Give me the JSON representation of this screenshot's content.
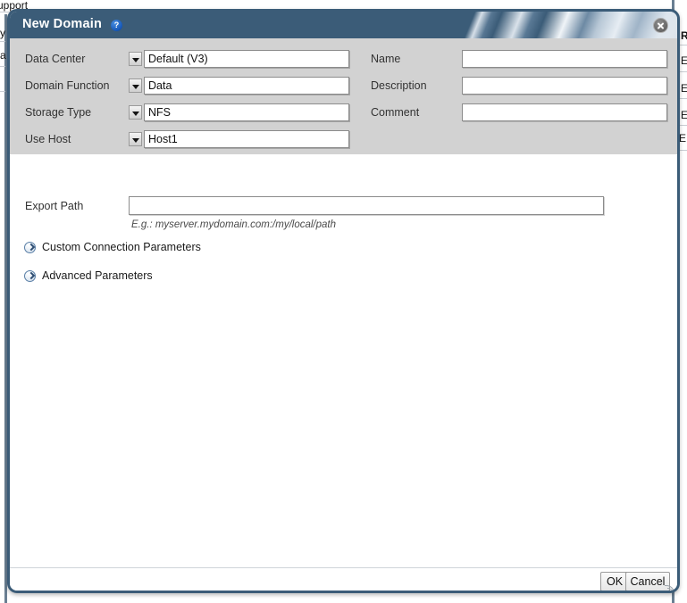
{
  "dialog": {
    "title": "New Domain",
    "help_icon": "?",
    "close_icon": "close-icon"
  },
  "form": {
    "left_column": [
      {
        "label": "Data Center",
        "value": "Default (V3)",
        "control": "dropdown"
      },
      {
        "label": "Domain Function",
        "value": "Data",
        "control": "dropdown"
      },
      {
        "label": "Storage Type",
        "value": "NFS",
        "control": "dropdown"
      },
      {
        "label": "Use Host",
        "value": "Host1",
        "control": "dropdown"
      }
    ],
    "right_column": [
      {
        "label": "Name",
        "value": "",
        "placeholder": "",
        "control": "text"
      },
      {
        "label": "Description",
        "value": "",
        "placeholder": "",
        "control": "text"
      },
      {
        "label": "Comment",
        "value": "",
        "placeholder": "",
        "control": "text"
      }
    ],
    "export": {
      "label": "Export Path",
      "value": "",
      "placeholder": "",
      "hint": "E.g.: myserver.mydomain.com:/my/local/path"
    },
    "expanders": [
      {
        "label": "Custom Connection Parameters",
        "expanded": false
      },
      {
        "label": "Advanced Parameters",
        "expanded": false
      }
    ]
  },
  "footer": {
    "ok_label": "OK",
    "cancel_label": "Cancel"
  },
  "background": {
    "top_fragment": "upport",
    "left_fragments": [
      "y",
      "a"
    ],
    "right_fragments": [
      "R",
      "E",
      "E",
      "E",
      "E"
    ]
  },
  "colors": {
    "titlebar": "#3b5c78",
    "dialog_border": "#3b5c78",
    "panel_gray": "#d2d2d2",
    "body_white": "#ffffff",
    "help_blue": "#1557b8",
    "text_dark": "#323232"
  }
}
